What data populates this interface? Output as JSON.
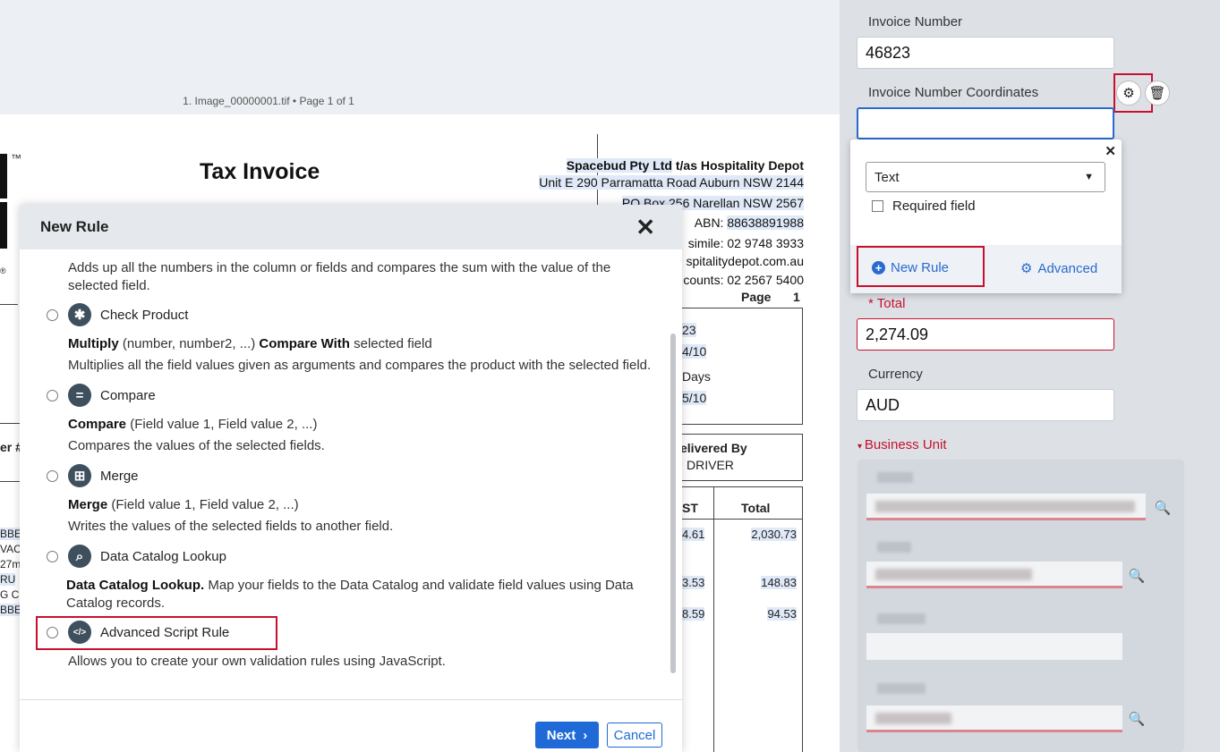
{
  "viewer": {
    "caption": "1. Image_00000001.tif • Page 1 of 1",
    "doc": {
      "title": "Tax Invoice",
      "tm": "™",
      "reg": "®",
      "company_name": "Spacebud Pty Ltd",
      "company_suffix": " t/as Hospitality Depot",
      "address1": "Unit E 290 Parramatta Road Auburn NSW 2144",
      "address2": "PO Box 256 Narellan NSW 2567",
      "abn_label": "ABN: ",
      "abn": "88638891988",
      "fax": "simile: 02 9748 3933",
      "web": "spitalitydepot.com.au",
      "accounts": "counts: 02 2567 5400",
      "page_label": "Page",
      "page_num": "1",
      "inv_no_partial": "23",
      "date_partial": "4/10",
      "terms_partial": "Days",
      "due_partial": "5/10",
      "delivered_by": "elivered By",
      "driver": "DRIVER",
      "gst_head": "ST",
      "total_head": "Total",
      "row1_gst": "4.61",
      "row1_total": "2,030.73",
      "row2_gst": "3.53",
      "row2_total": "148.83",
      "row3_gst": "8.59",
      "row3_total": "94.53",
      "left_er": "er #",
      "left_rows": [
        "BBE",
        "VAC",
        "27m",
        "RU",
        "G C",
        "BBE"
      ]
    }
  },
  "modal": {
    "title": "New Rule",
    "partial_desc": "Adds up all the numbers in the column or fields and compares the sum with the value of the selected field.",
    "options": [
      {
        "icon": "✱",
        "name": "Check Product",
        "syntax_bold": "Multiply",
        "syntax_rest": " (number, number2, ...) ",
        "syntax_bold2": "Compare With",
        "syntax_rest2": " selected field",
        "desc": "Multiplies all the field values given as arguments and compares the product with the selected field."
      },
      {
        "icon": "=",
        "name": "Compare",
        "syntax_bold": "Compare",
        "syntax_rest": " (Field value 1, Field value 2, ...)",
        "desc": "Compares the values of the selected fields."
      },
      {
        "icon": "⊞",
        "name": "Merge",
        "syntax_bold": "Merge",
        "syntax_rest": " (Field value 1, Field value 2, ...)",
        "desc": "Writes the values of the selected fields to another field."
      },
      {
        "icon": "⌕",
        "name": "Data Catalog Lookup",
        "syntax_bold": "Data Catalog Lookup.",
        "syntax_rest": "  Map your fields to the Data Catalog and validate field values using Data Catalog records."
      },
      {
        "icon": "</>",
        "name": "Advanced Script Rule",
        "desc": "Allows you to create your own validation rules using JavaScript."
      }
    ],
    "next_label": "Next",
    "cancel_label": "Cancel"
  },
  "panel": {
    "invoice_number_label": "Invoice Number",
    "invoice_number_value": "46823",
    "coords_label": "Invoice Number Coordinates",
    "coords_value": "",
    "popover": {
      "type_value": "Text",
      "required_label": "Required field",
      "new_rule_label": "New Rule",
      "advanced_label": "Advanced"
    },
    "total_label": "Total",
    "total_value": "2,274.09",
    "currency_label": "Currency",
    "currency_value": "AUD",
    "business_unit_label": "Business Unit"
  },
  "colors": {
    "accent": "#1f6ad6",
    "highlight": "#c8102e",
    "panel_bg": "#dde1e6"
  }
}
